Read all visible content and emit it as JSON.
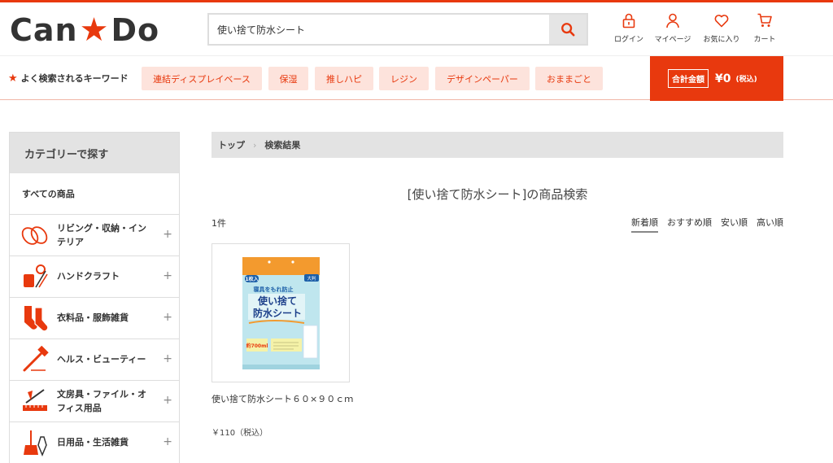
{
  "header": {
    "logo": {
      "left": "Can",
      "right": "Do"
    },
    "search": {
      "value": "使い捨て防水シート",
      "placeholder": ""
    },
    "nav": [
      {
        "label": "ログイン",
        "icon": "lock-icon"
      },
      {
        "label": "マイページ",
        "icon": "user-icon"
      },
      {
        "label": "お気に入り",
        "icon": "heart-icon"
      },
      {
        "label": "カート",
        "icon": "cart-icon"
      }
    ]
  },
  "keywords": {
    "title": "よく検索されるキーワード",
    "items": [
      "連結ディスプレイベース",
      "保湿",
      "推しハピ",
      "レジン",
      "デザインペーパー",
      "おままごと"
    ]
  },
  "cart_total": {
    "label": "合計金額",
    "amount": "¥0",
    "tax": "(税込)"
  },
  "sidebar": {
    "title": "カテゴリーで探す",
    "all": "すべての商品",
    "items": [
      {
        "label": "リビング・収納・インテリア",
        "icon": "slippers-icon"
      },
      {
        "label": "ハンドクラフト",
        "icon": "craft-tools-icon"
      },
      {
        "label": "衣料品・服飾雑貨",
        "icon": "socks-icon"
      },
      {
        "label": "ヘルス・ビューティー",
        "icon": "razor-icon"
      },
      {
        "label": "文房具・ファイル・オフィス用品",
        "icon": "stationery-icon"
      },
      {
        "label": "日用品・生活雑貨",
        "icon": "broom-icon"
      }
    ]
  },
  "breadcrumb": {
    "home": "トップ",
    "current": "検索結果"
  },
  "page_title": "[使い捨て防水シート]の商品検索",
  "result_count": "1件",
  "sort": {
    "options": [
      "新着順",
      "おすすめ順",
      "安い順",
      "高い順"
    ],
    "active": "新着順"
  },
  "product": {
    "name": "使い捨て防水シート６０×９０ｃｍ",
    "price": "￥110（税込）",
    "package": {
      "badge": "1枚入",
      "catch": "寝具をもれ防止",
      "title_1": "使い捨て",
      "title_2": "防水シート",
      "volume": "約700ml",
      "size_tag": "大判"
    }
  },
  "colors": {
    "brand": "#e8390e",
    "keyword_bg": "#fde3dc",
    "panel_gray": "#e3e3e3"
  }
}
